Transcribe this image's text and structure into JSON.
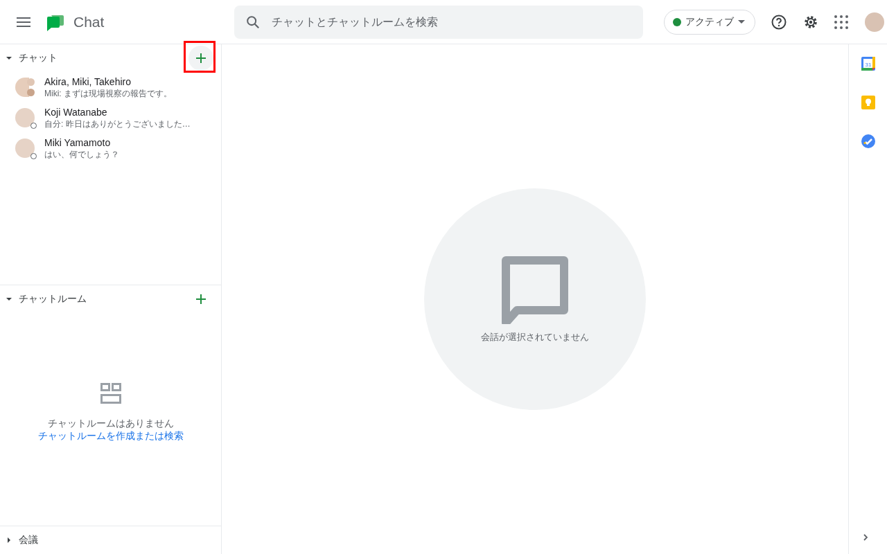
{
  "header": {
    "app_name": "Chat",
    "search": {
      "placeholder": "チャットとチャットルームを検索"
    },
    "status": {
      "label": "アクティブ",
      "color": "#1e8e3e"
    }
  },
  "sections": [
    {
      "title": "チャット",
      "expanded": true,
      "add_highlighted": true,
      "kind": "chats",
      "items": [
        {
          "name": "Akira, Miki, Takehiro",
          "preview": "Miki: まずは現場視察の報告です。",
          "group": true,
          "presence_ring": false
        },
        {
          "name": "Koji Watanabe",
          "preview": "自分: 昨日はありがとうございました…",
          "group": false,
          "presence_ring": true
        },
        {
          "name": "Miki Yamamoto",
          "preview": "はい、何でしょう？",
          "group": false,
          "presence_ring": true
        }
      ]
    },
    {
      "title": "チャットルーム",
      "expanded": true,
      "add_highlighted": false,
      "kind": "rooms",
      "empty_text": "チャットルームはありません",
      "empty_link": "チャットルームを作成または検索"
    },
    {
      "title": "会議",
      "expanded": false,
      "kind": "meetings"
    }
  ],
  "main": {
    "empty_text": "会話が選択されていません"
  },
  "side_panel": {
    "calendar_day": "31"
  }
}
